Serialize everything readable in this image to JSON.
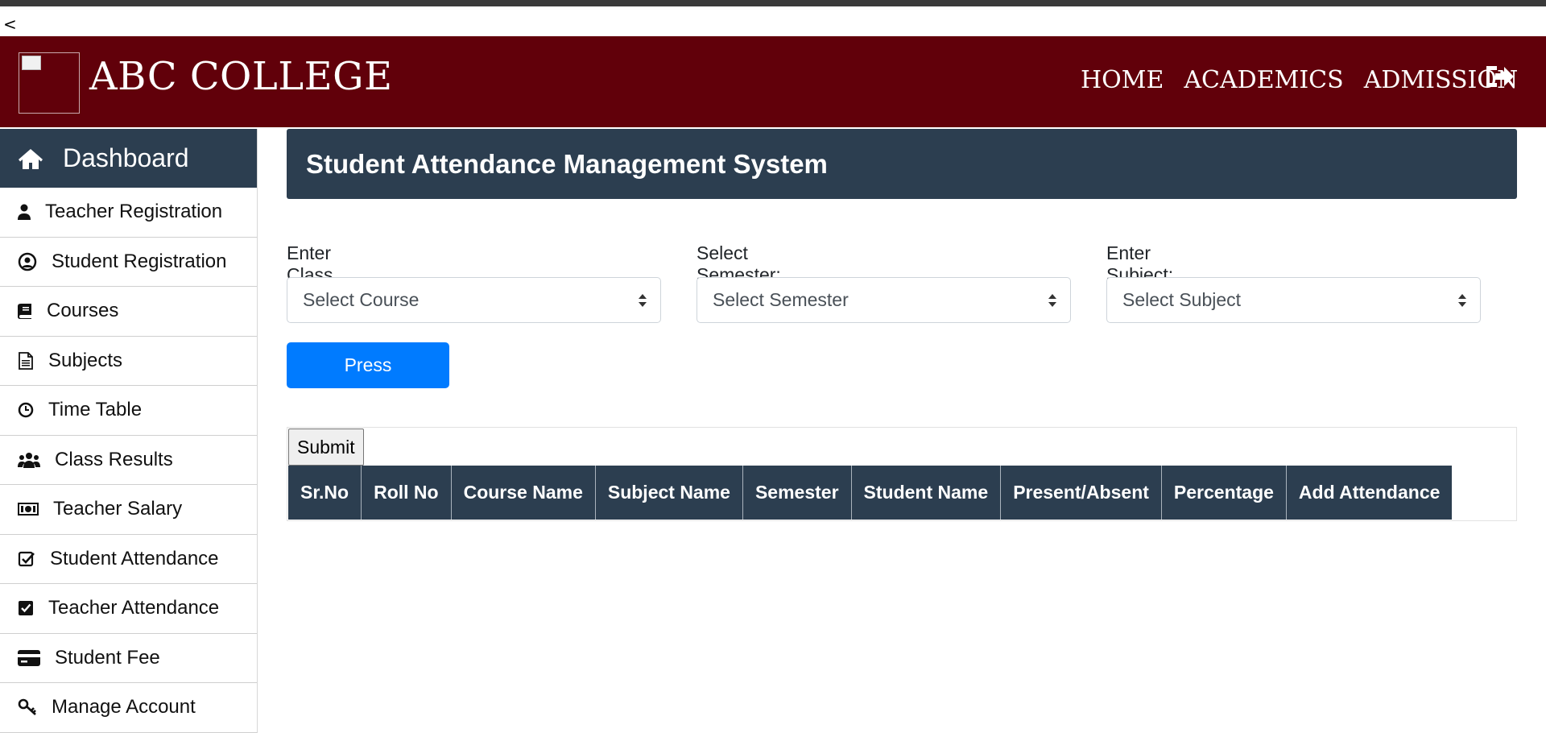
{
  "back": {
    "label": "<"
  },
  "header": {
    "brand": "ABC COLLEGE",
    "nav": [
      "HOME",
      "ACADEMICS",
      "ADMISSION"
    ],
    "logout_icon": "sign-out-icon",
    "bg_color": "#61000a"
  },
  "sidebar": {
    "dashboard": {
      "label": "Dashboard",
      "icon": "home-icon"
    },
    "items": [
      {
        "label": "Teacher Registration",
        "icon": "user-icon"
      },
      {
        "label": "Student Registration",
        "icon": "user-circle-icon"
      },
      {
        "label": "Courses",
        "icon": "book-icon"
      },
      {
        "label": "Subjects",
        "icon": "file-text-icon"
      },
      {
        "label": "Time Table",
        "icon": "clock-icon"
      },
      {
        "label": "Class Results",
        "icon": "users-icon"
      },
      {
        "label": "Teacher Salary",
        "icon": "money-icon"
      },
      {
        "label": "Student Attendance",
        "icon": "check-square-outline-icon"
      },
      {
        "label": "Teacher Attendance",
        "icon": "check-square-solid-icon"
      },
      {
        "label": "Student Fee",
        "icon": "credit-card-icon"
      },
      {
        "label": "Manage Account",
        "icon": "key-icon"
      }
    ]
  },
  "main": {
    "title": "Student Attendance Management System",
    "filters": {
      "class": {
        "label": "Enter Class Id:",
        "value": "Select Course"
      },
      "semester": {
        "label": "Select Semester:",
        "value": "Select Semester"
      },
      "subject": {
        "label": "Enter Subject:",
        "value": "Select Subject"
      }
    },
    "press_label": "Press",
    "submit_label": "Submit",
    "table": {
      "columns": [
        "Sr.No",
        "Roll No",
        "Course Name",
        "Subject Name",
        "Semester",
        "Student Name",
        "Present/Absent",
        "Percentage",
        "Add Attendance"
      ],
      "rows": []
    }
  },
  "colors": {
    "accent": "#2c3e50",
    "primary_button": "#007bff"
  }
}
